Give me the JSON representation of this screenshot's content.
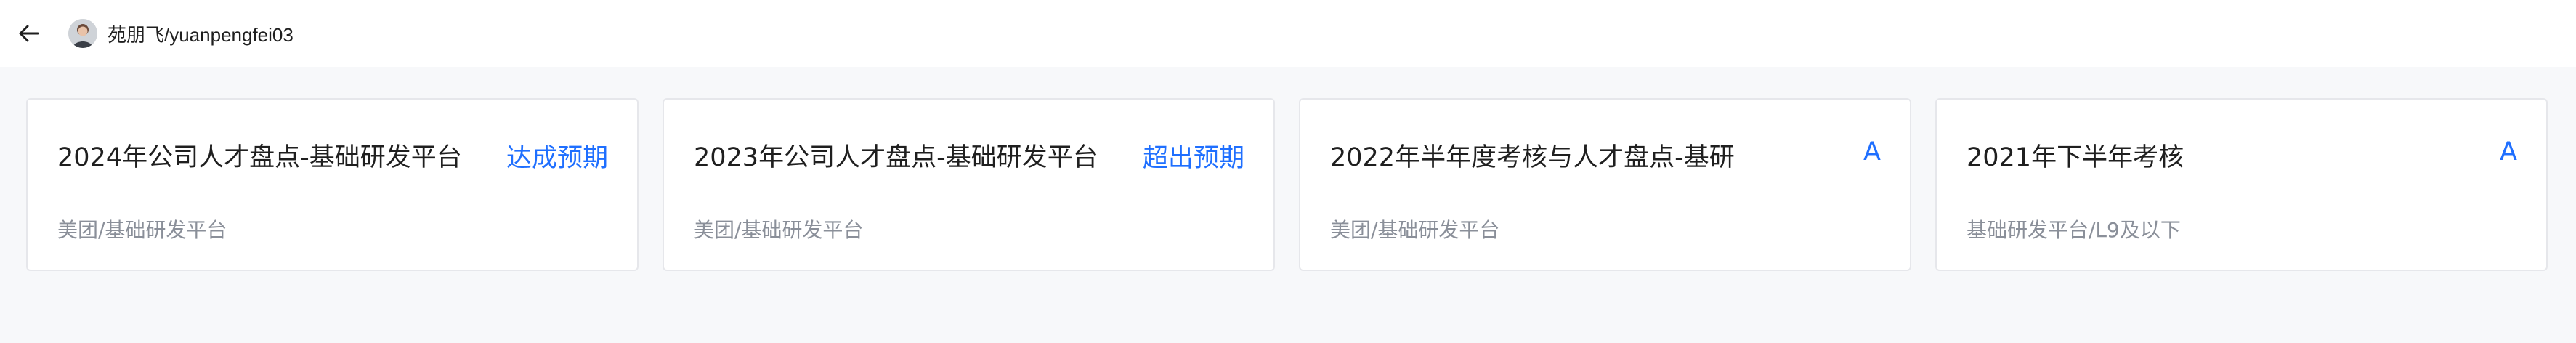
{
  "header": {
    "back_icon": "arrow-left-icon",
    "user_name": "苑朋飞/yuanpengfei03"
  },
  "cards": [
    {
      "title": "2024年公司人才盘点-基础研发平台",
      "rating": "达成预期",
      "subtitle": "美团/基础研发平台"
    },
    {
      "title": "2023年公司人才盘点-基础研发平台",
      "rating": "超出预期",
      "subtitle": "美团/基础研发平台"
    },
    {
      "title": "2022年半年度考核与人才盘点-基研",
      "rating": "A",
      "subtitle": "美团/基础研发平台"
    },
    {
      "title": "2021年下半年考核",
      "rating": "A",
      "subtitle": "基础研发平台/L9及以下"
    }
  ],
  "colors": {
    "accent": "#1f6fff",
    "title_text": "#1f1f1f",
    "sub_text": "#8a8f99",
    "card_border": "#e6e7eb",
    "page_bg": "#f7f8fa"
  }
}
